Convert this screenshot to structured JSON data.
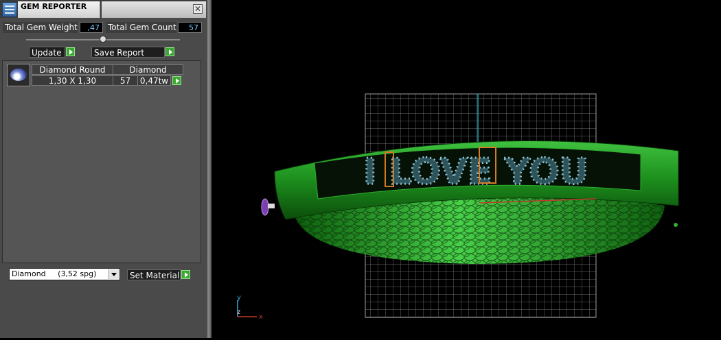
{
  "window": {
    "title": "GEM REPORTER",
    "close_glyph": "✕"
  },
  "stats": {
    "weight_label": "Total Gem Weight",
    "weight_value": ",47",
    "count_label": "Total Gem Count",
    "count_value": "57"
  },
  "actions": {
    "update_label": "Update",
    "save_label": "Save Report"
  },
  "gem_table": {
    "headers": [
      "Diamond Round",
      "Diamond"
    ],
    "rows": [
      {
        "size": "1,30 X 1,30",
        "count": "57",
        "weight": "0,47tw",
        "thumbnail_icon": "round-diamond-icon"
      }
    ]
  },
  "material": {
    "selected": "Diamond     (3,52 spg)",
    "set_label": "Set Material"
  },
  "viewport": {
    "ring_text": "I LOVE YOU",
    "axis_labels": {
      "x": "x",
      "y": "y",
      "z": "z"
    }
  },
  "colors": {
    "ring_green": "#1f9a1f",
    "grid": "#9a9a9a",
    "gem_blue": "#9fd3e6",
    "prong_orange": "#d47b28",
    "value_text": "#7ec8ff",
    "go_green": "#3aa832"
  }
}
